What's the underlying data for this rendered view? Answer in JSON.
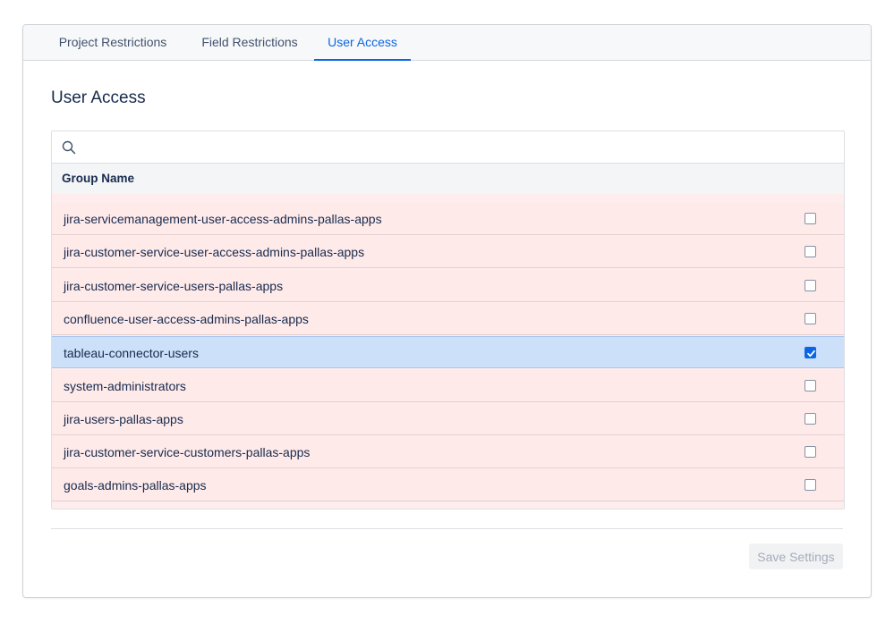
{
  "tabs": [
    {
      "label": "Project Restrictions",
      "active": false
    },
    {
      "label": "Field Restrictions",
      "active": false
    },
    {
      "label": "User Access",
      "active": true
    }
  ],
  "page": {
    "title": "User Access"
  },
  "search": {
    "value": "",
    "placeholder": ""
  },
  "table": {
    "column_header": "Group Name",
    "rows": [
      {
        "label": "jira-servicemanagement-user-access-admins-pallas-apps",
        "checked": false
      },
      {
        "label": "jira-customer-service-user-access-admins-pallas-apps",
        "checked": false
      },
      {
        "label": "jira-customer-service-users-pallas-apps",
        "checked": false
      },
      {
        "label": "confluence-user-access-admins-pallas-apps",
        "checked": false
      },
      {
        "label": "tableau-connector-users",
        "checked": true
      },
      {
        "label": "system-administrators",
        "checked": false
      },
      {
        "label": "jira-users-pallas-apps",
        "checked": false
      },
      {
        "label": "jira-customer-service-customers-pallas-apps",
        "checked": false
      },
      {
        "label": "goals-admins-pallas-apps",
        "checked": false
      }
    ]
  },
  "actions": {
    "save_label": "Save Settings",
    "save_disabled": true
  },
  "colors": {
    "accent": "#0c66e4",
    "row_restricted": "#ffeaea",
    "row_selected": "#cce0fa"
  },
  "icons": {
    "search": "search-icon",
    "check": "check-icon"
  }
}
